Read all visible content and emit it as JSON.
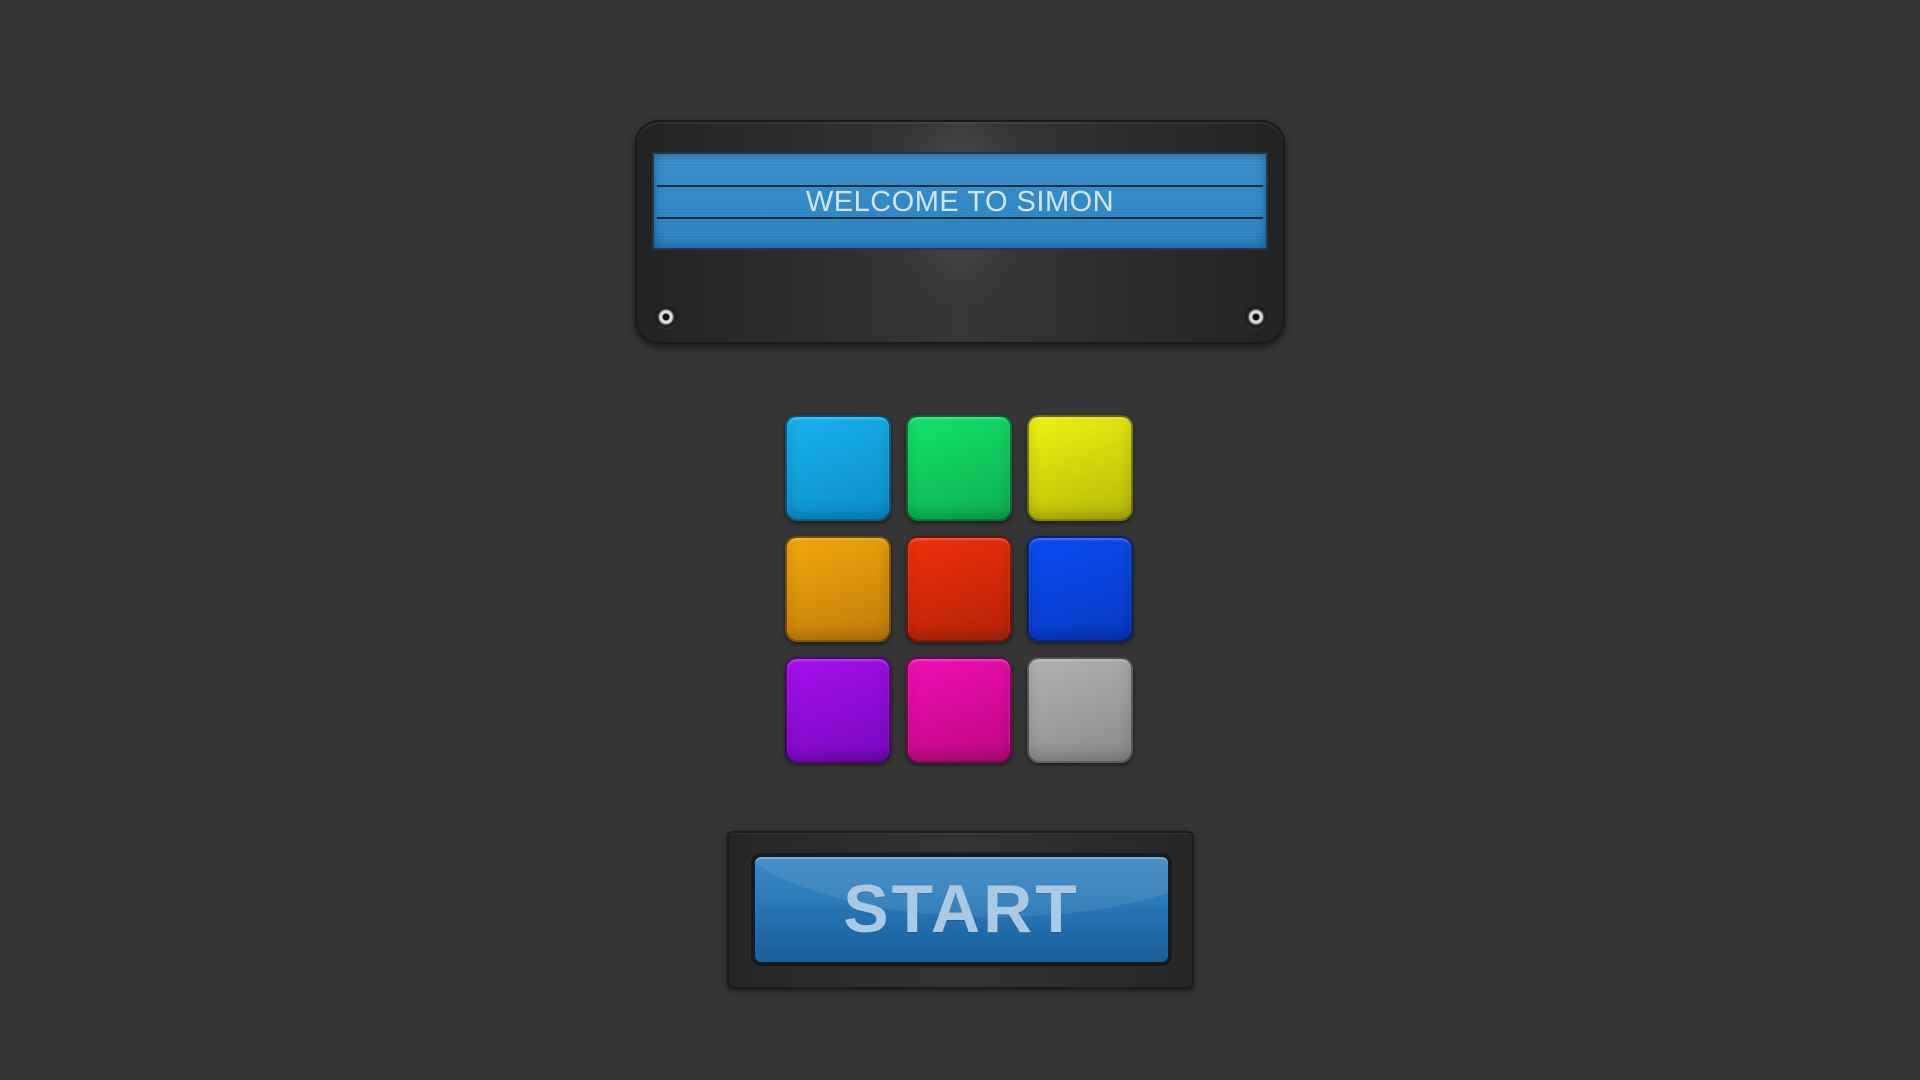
{
  "display": {
    "message": "WELCOME TO SIMON"
  },
  "pads": [
    {
      "name": "cyan",
      "top": "#19b3ee",
      "bottom": "#0a8cc8"
    },
    {
      "name": "green",
      "top": "#14e36c",
      "bottom": "#0cb04f"
    },
    {
      "name": "yellow",
      "top": "#eef20f",
      "bottom": "#b8b80a"
    },
    {
      "name": "orange",
      "top": "#f2a70c",
      "bottom": "#c07c0a"
    },
    {
      "name": "red",
      "top": "#f0310c",
      "bottom": "#b42208"
    },
    {
      "name": "blue",
      "top": "#0a4cf2",
      "bottom": "#0838c2"
    },
    {
      "name": "purple",
      "top": "#a60fee",
      "bottom": "#7708bd"
    },
    {
      "name": "magenta",
      "top": "#f30fb5",
      "bottom": "#b9087f"
    },
    {
      "name": "gray",
      "top": "#b2b2b2",
      "bottom": "#8a8a8a"
    }
  ],
  "start": {
    "label": "START"
  }
}
